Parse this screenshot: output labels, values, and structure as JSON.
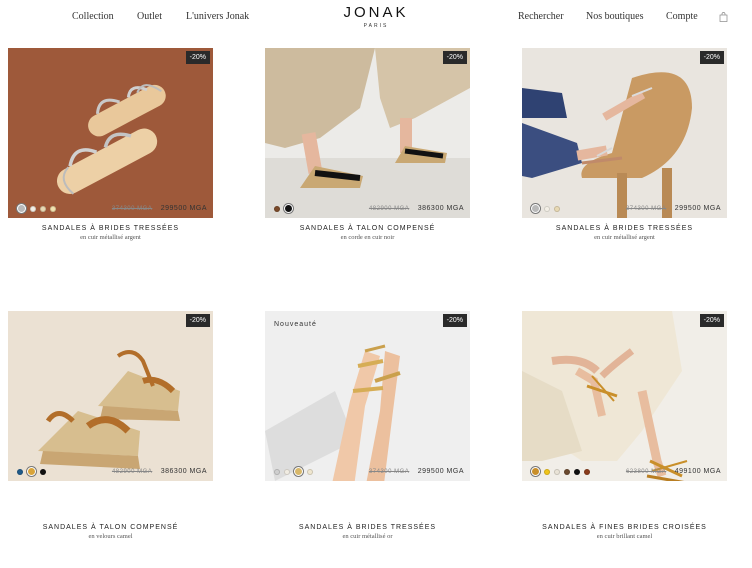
{
  "header": {
    "nav_left": [
      "Collection",
      "Outlet",
      "L'univers Jonak"
    ],
    "logo": "JONAK",
    "logo_sub": "PARIS",
    "nav_right": [
      "Rechercher",
      "Nos boutiques",
      "Compte"
    ],
    "cart_icon": "bag-icon"
  },
  "products": [
    {
      "badge": "-20%",
      "old_price": "374300 MGA",
      "price": "299500 MGA",
      "title": "SANDALES À BRIDES TRESSÉES",
      "subtitle": "en cuir métallisé argent",
      "swatches": [
        "#b9b9b9",
        "#f3efe6",
        "#e8d9b4",
        "#f2e3b0"
      ],
      "selected_swatch": 0
    },
    {
      "badge": "-20%",
      "old_price": "482900 MGA",
      "price": "386300 MGA",
      "title": "SANDALES À TALON COMPENSÉ",
      "subtitle": "en corde en cuir noir",
      "swatches": [
        "#7a4a2a",
        "#111111"
      ],
      "selected_swatch": 1
    },
    {
      "badge": "-20%",
      "old_price": "374300 MGA",
      "price": "299500 MGA",
      "title": "SANDALES À BRIDES TRESSÉES",
      "subtitle": "en cuir métallisé argent",
      "swatches": [
        "#b9b9b9",
        "#f3efe6",
        "#e8d9b4"
      ],
      "selected_swatch": 0
    },
    {
      "badge": "-20%",
      "old_price": "482900 MGA",
      "price": "386300 MGA",
      "title": "SANDALES À TALON COMPENSÉ",
      "subtitle": "en velours camel",
      "swatches": [
        "#1f5a8a",
        "#d9a43a",
        "#111111"
      ],
      "selected_swatch": 1,
      "new_label": ""
    },
    {
      "badge": "-20%",
      "new_label": "Nouveauté",
      "old_price": "374300 MGA",
      "price": "299500 MGA",
      "title": "SANDALES À BRIDES TRESSÉES",
      "subtitle": "en cuir métallisé or",
      "swatches": [
        "#cfcfcf",
        "#f1ece2",
        "#d8b86a",
        "#efe6cf"
      ],
      "selected_swatch": 2
    },
    {
      "badge": "-20%",
      "old_price": "623800 MGA",
      "price": "499100 MGA",
      "title": "SANDALES À FINES BRIDES CROISÉES",
      "subtitle": "en cuir brillant camel",
      "swatches": [
        "#c98f2a",
        "#f0c419",
        "#e9e3d6",
        "#6b4a2f",
        "#111111",
        "#8a3b1a"
      ],
      "selected_swatch": 0
    }
  ]
}
